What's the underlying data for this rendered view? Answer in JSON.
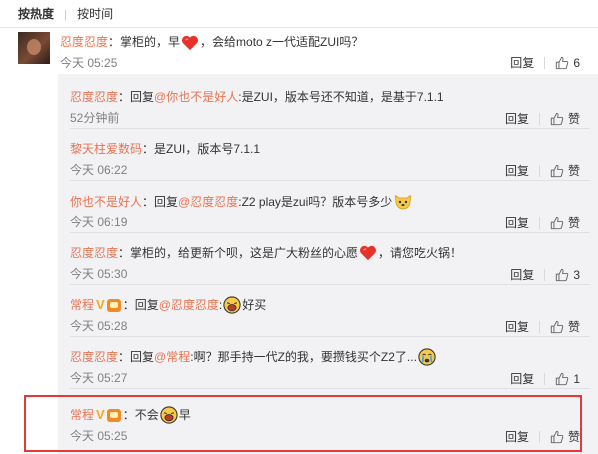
{
  "sort": {
    "hot": "按热度",
    "sep": "|",
    "time": "按时间"
  },
  "top_comment": {
    "author": "忍度忍度",
    "colon": "：",
    "text_before": "掌柜的，早",
    "text_after": "，会给moto z一代适配ZUI吗？",
    "time": "今天 05:25",
    "reply": "回复",
    "like_count": "6"
  },
  "replies": [
    {
      "author": "忍度忍度",
      "colon": "：",
      "prefix": "回复",
      "at": "@你也不是好人",
      "text": ":是ZUI，版本号还不知道，是基于7.1.1",
      "text2": "",
      "time": "52分钟前",
      "reply": "回复",
      "like": "赞"
    },
    {
      "author": "黎天柱爱数码",
      "colon": "：",
      "prefix": "",
      "at": "",
      "text": "是ZUI，版本号7.1.1",
      "text2": "",
      "time": "今天 06:22",
      "reply": "回复",
      "like": "赞"
    },
    {
      "author": "你也不是好人",
      "colon": "：",
      "prefix": "回复",
      "at": "@忍度忍度",
      "text": ":Z2 play是zui吗？版本号多少",
      "text2": "",
      "time": "今天 06:19",
      "reply": "回复",
      "like": "赞"
    },
    {
      "author": "忍度忍度",
      "colon": "：",
      "prefix": "",
      "at": "",
      "text": "掌柜的，给更新个呗，这是广大粉丝的心愿",
      "text2": "，请您吃火锅！",
      "time": "今天 05:30",
      "reply": "回复",
      "like": "3"
    },
    {
      "author": "常程",
      "colon": "：",
      "prefix": "回复",
      "at": "@忍度忍度",
      "text": ":",
      "text2": "好买",
      "time": "今天 05:28",
      "reply": "回复",
      "like": "赞"
    },
    {
      "author": "忍度忍度",
      "colon": "：",
      "prefix": "回复",
      "at": "@常程",
      "text": ":啊？那手持一代Z的我，要攒钱买个Z2了...",
      "text2": "",
      "time": "今天 05:27",
      "reply": "回复",
      "like": "1"
    },
    {
      "author": "常程",
      "colon": "：",
      "prefix": "",
      "at": "",
      "text": "不会",
      "text2": "早",
      "time": "今天 05:25",
      "reply": "回复",
      "like": "赞"
    }
  ],
  "badges": {
    "verified": "V"
  },
  "colors": {
    "nickname": "#eb7350",
    "highlight": "#e53935",
    "reply_bg": "#f2f2f5"
  },
  "icons": {
    "like": "thumbs-up-icon",
    "heart": "heart-emoji-icon",
    "laugh": "laughing-emoji-icon",
    "cry": "crying-emoji-icon",
    "dog": "dog-emoji-icon"
  }
}
